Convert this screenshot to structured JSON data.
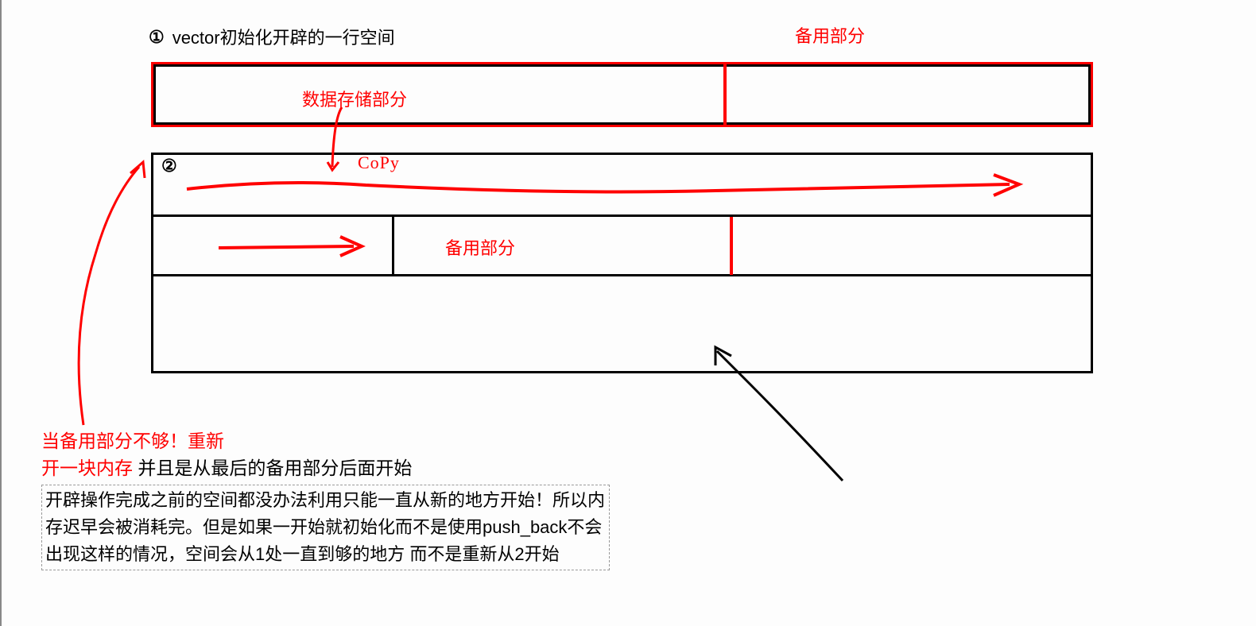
{
  "labels": {
    "title": "vector初始化开辟的一行空间",
    "reserve_top": "备用部分",
    "data_store": "数据存储部分",
    "reserve_middle": "备用部分",
    "copy": "CoPy",
    "circled_one": "①",
    "circled_two": "②"
  },
  "bottom": {
    "red_line1": "当备用部分不够！重新",
    "red_line2a": "开一块内存",
    "red_line2b": " 并且是从最后的备用部分后面开始",
    "body": "开辟操作完成之前的空间都没办法利用只能一直从新的地方开始！所以内存迟早会被消耗完。但是如果一开始就初始化而不是使用push_back不会出现这样的情况，空间会从1处一直到够的地方  而不是重新从2开始"
  },
  "colors": {
    "accent_red": "#ff0000",
    "black": "#000000"
  }
}
